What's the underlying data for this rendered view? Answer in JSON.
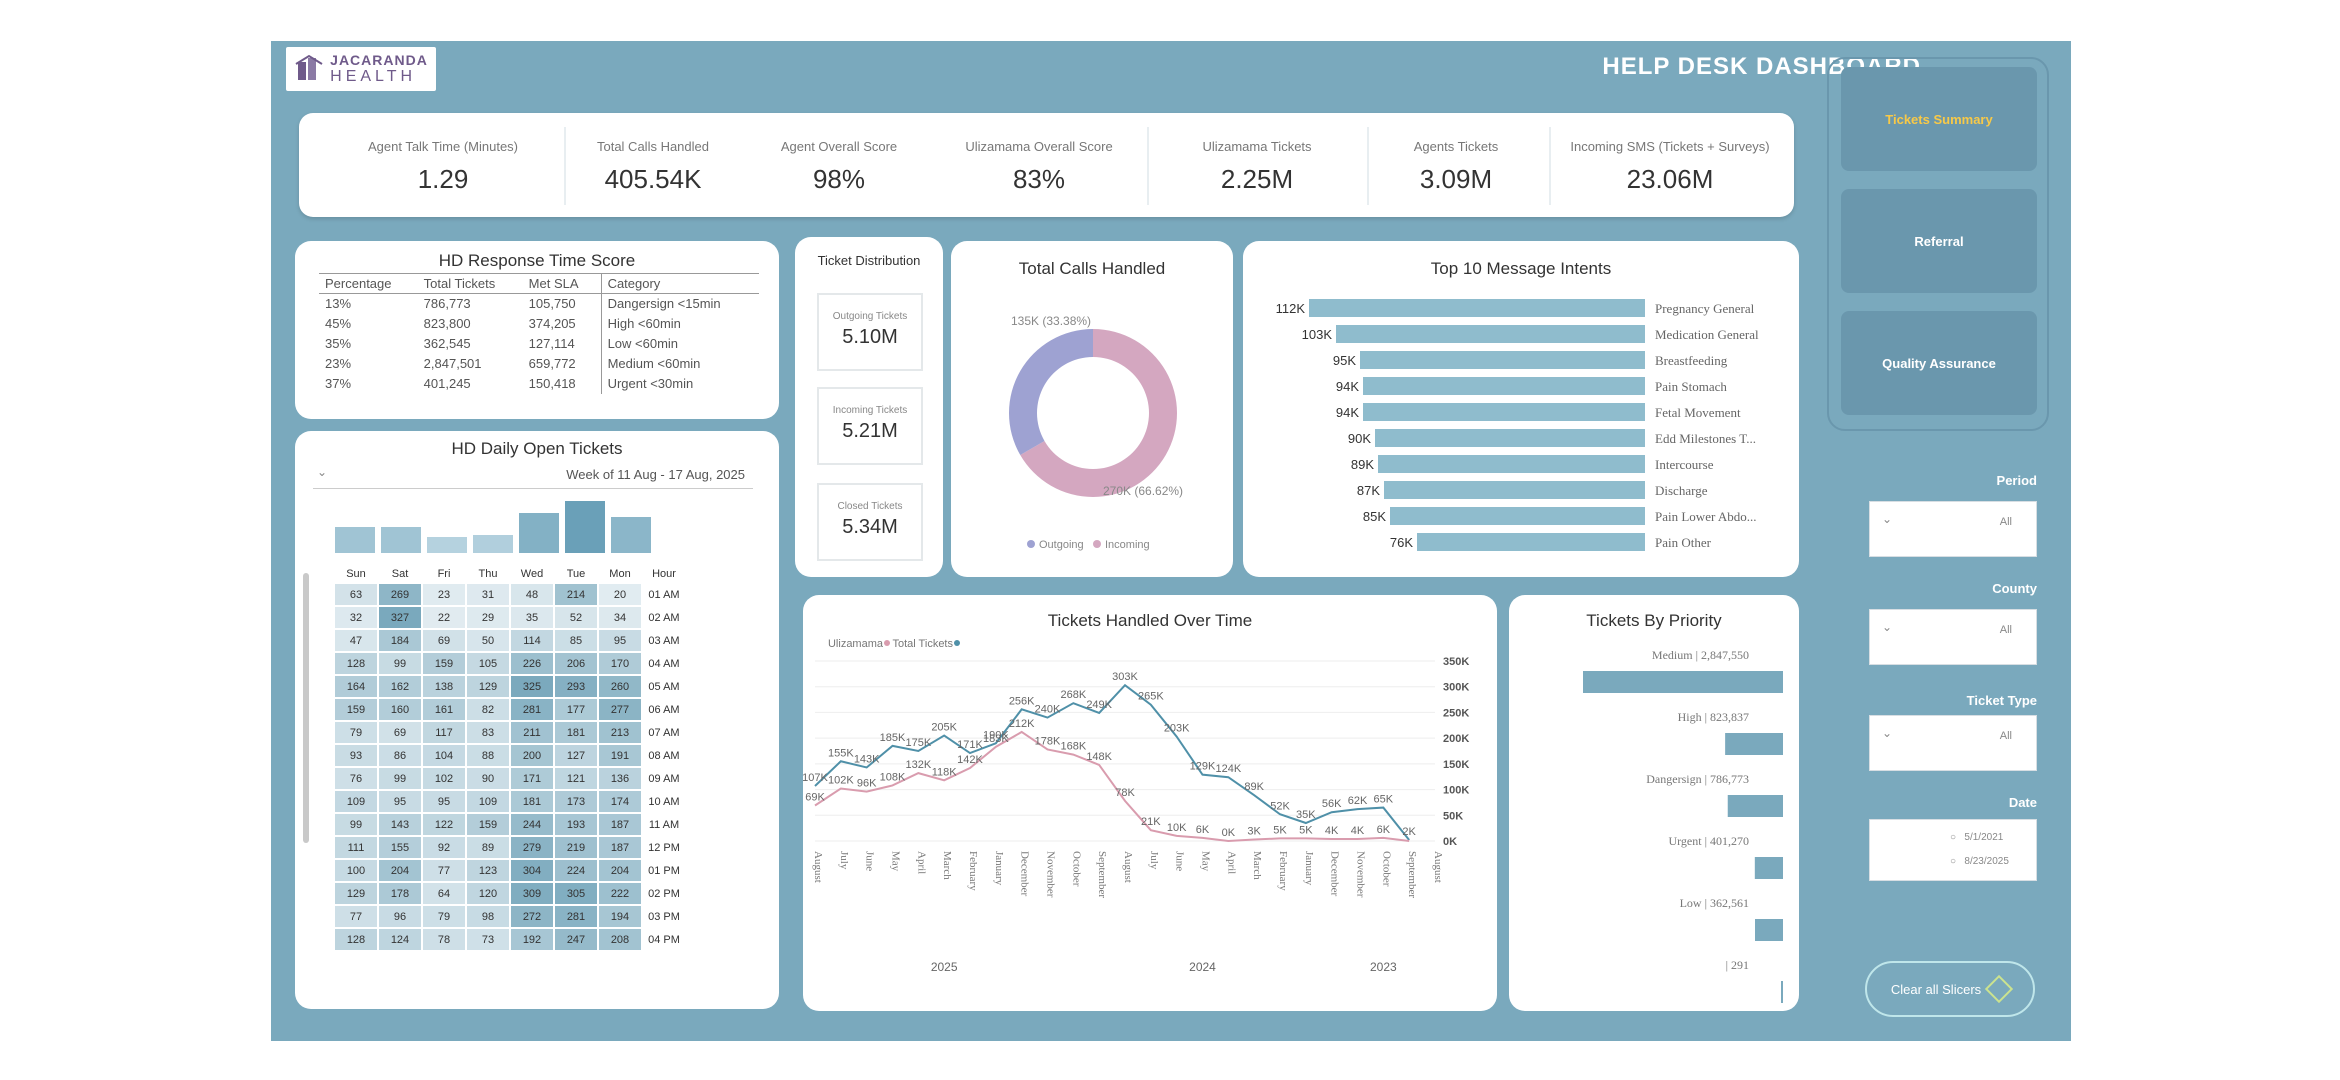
{
  "header": {
    "title": "HELP DESK DASHBOARD",
    "logo_top": "JACARANDA",
    "logo_bottom": "HEALTH"
  },
  "kpis": [
    {
      "label": "Incoming SMS (Tickets + Surveys)",
      "value": "23.06M"
    },
    {
      "label": "Agents Tickets",
      "value": "3.09M"
    },
    {
      "label": "Ulizamama Tickets",
      "value": "2.25M"
    },
    {
      "label": "Ulizamama Overall Score",
      "value": "83%"
    },
    {
      "label": "Agent Overall Score",
      "value": "98%"
    },
    {
      "label": "Total Calls Handled",
      "value": "405.54K"
    },
    {
      "label": "Agent Talk Time (Minutes)",
      "value": "1.29"
    }
  ],
  "nav": {
    "tickets_summary": "Tickets Summary",
    "referral": "Referral",
    "quality_assurance": "Quality Assurance",
    "active_color": "#f7c948"
  },
  "filters": {
    "period": {
      "label": "Period",
      "value": "All"
    },
    "county": {
      "label": "County",
      "value": "All"
    },
    "ticket_type": {
      "label": "Ticket Type",
      "value": "All"
    },
    "date": {
      "label": "Date",
      "start": "5/1/2021",
      "end": "8/23/2025"
    },
    "clear": "Clear all Slicers"
  },
  "hd_response": {
    "title": "HD Response Time Score",
    "columns": [
      "Category",
      "Met SLA",
      "Total Tickets",
      "Percentage"
    ],
    "rows": [
      [
        "Dangersign <15min",
        "105,750",
        "786,773",
        "13%"
      ],
      [
        "High <60min",
        "374,205",
        "823,800",
        "45%"
      ],
      [
        "Low <60min",
        "127,114",
        "362,545",
        "35%"
      ],
      [
        "Medium <60min",
        "659,772",
        "2,847,501",
        "23%"
      ],
      [
        "Urgent <30min",
        "150,418",
        "401,245",
        "37%"
      ]
    ]
  },
  "ticket_distribution": {
    "title": "Ticket Distribution",
    "outgoing_label": "Outgoing Tickets",
    "outgoing_value": "5.10M",
    "incoming_label": "Incoming Tickets",
    "incoming_value": "5.21M",
    "closed_label": "Closed Tickets",
    "closed_value": "5.34M"
  },
  "calls_handled": {
    "title": "Total Calls Handled",
    "incoming_label": "270K (66.62%)",
    "outgoing_label": "135K (33.38%)",
    "legend_incoming": "Incoming",
    "legend_outgoing": "Outgoing",
    "incoming_color": "#d4a7c0",
    "outgoing_color": "#9ea2d2",
    "incoming_value": 270,
    "outgoing_value": 135
  },
  "message_intents": {
    "title": "Top 10 Message Intents",
    "color": "#8fbccd",
    "rows": [
      {
        "name": "Pregnancy General",
        "label": "112K",
        "value": 112
      },
      {
        "name": "Medication General",
        "label": "103K",
        "value": 103
      },
      {
        "name": "Breastfeeding",
        "label": "95K",
        "value": 95
      },
      {
        "name": "Pain Stomach",
        "label": "94K",
        "value": 94
      },
      {
        "name": "Fetal Movement",
        "label": "94K",
        "value": 94
      },
      {
        "name": "Edd Milestones T...",
        "label": "90K",
        "value": 90
      },
      {
        "name": "Intercourse",
        "label": "89K",
        "value": 89
      },
      {
        "name": "Discharge",
        "label": "87K",
        "value": 87
      },
      {
        "name": "Pain Lower Abdo...",
        "label": "85K",
        "value": 85
      },
      {
        "name": "Pain Other",
        "label": "76K",
        "value": 76
      }
    ]
  },
  "open_tickets": {
    "title": "HD Daily Open Tickets",
    "week": "Week of 11 Aug - 17 Aug, 2025",
    "hour_label": "Hour",
    "days": [
      "Mon",
      "Tue",
      "Wed",
      "Thu",
      "Fri",
      "Sat",
      "Sun"
    ],
    "day_totals": [
      18,
      26,
      20,
      9,
      8,
      13,
      13
    ],
    "rows": [
      {
        "h": "01 AM",
        "v": [
          20,
          214,
          48,
          31,
          23,
          269,
          63
        ]
      },
      {
        "h": "02 AM",
        "v": [
          34,
          52,
          35,
          29,
          22,
          327,
          32
        ]
      },
      {
        "h": "03 AM",
        "v": [
          95,
          85,
          114,
          50,
          69,
          184,
          47
        ]
      },
      {
        "h": "04 AM",
        "v": [
          170,
          206,
          226,
          105,
          159,
          99,
          128
        ]
      },
      {
        "h": "05 AM",
        "v": [
          260,
          293,
          325,
          129,
          138,
          162,
          164
        ]
      },
      {
        "h": "06 AM",
        "v": [
          277,
          177,
          281,
          82,
          161,
          160,
          159
        ]
      },
      {
        "h": "07 AM",
        "v": [
          213,
          181,
          211,
          83,
          117,
          69,
          79
        ]
      },
      {
        "h": "08 AM",
        "v": [
          191,
          127,
          200,
          88,
          104,
          86,
          93
        ]
      },
      {
        "h": "09 AM",
        "v": [
          136,
          121,
          171,
          90,
          102,
          99,
          76
        ]
      },
      {
        "h": "10 AM",
        "v": [
          174,
          173,
          181,
          109,
          95,
          95,
          109
        ]
      },
      {
        "h": "11 AM",
        "v": [
          187,
          193,
          244,
          159,
          122,
          143,
          99
        ]
      },
      {
        "h": "12 PM",
        "v": [
          187,
          219,
          279,
          89,
          92,
          155,
          111
        ]
      },
      {
        "h": "01 PM",
        "v": [
          204,
          224,
          304,
          123,
          77,
          204,
          100
        ]
      },
      {
        "h": "02 PM",
        "v": [
          222,
          305,
          309,
          120,
          64,
          178,
          129
        ]
      },
      {
        "h": "03 PM",
        "v": [
          194,
          281,
          272,
          98,
          79,
          96,
          77
        ]
      },
      {
        "h": "04 PM",
        "v": [
          208,
          247,
          192,
          73,
          78,
          124,
          128
        ]
      }
    ]
  },
  "chart_data": [
    {
      "type": "line",
      "title": "Tickets Handled Over Time",
      "x": [
        "August 2025",
        "July 2025",
        "June 2025",
        "May 2025",
        "April 2025",
        "March 2025",
        "February 2025",
        "January 2025",
        "December 2024",
        "November 2024",
        "October 2024",
        "September 2024",
        "August 2024",
        "July 2024",
        "June 2024",
        "May 2024",
        "April 2024",
        "March 2024",
        "February 2024",
        "January 2024",
        "December 2023",
        "November 2023",
        "October 2023",
        "September 2023",
        "August 2023"
      ],
      "x_tick_labels": [
        "August",
        "July",
        "June",
        "May",
        "April",
        "March",
        "February",
        "January",
        "December",
        "November",
        "October",
        "September",
        "August",
        "July",
        "June",
        "May",
        "April",
        "March",
        "February",
        "January",
        "December",
        "November",
        "October",
        "September",
        "August"
      ],
      "year_labels": [
        "2025",
        "2024",
        "2023"
      ],
      "series": [
        {
          "name": "Total Tickets",
          "color": "#4f90a8",
          "values": [
            107,
            155,
            143,
            185,
            175,
            205,
            171,
            190,
            256,
            240,
            268,
            249,
            303,
            265,
            203,
            129,
            124,
            89,
            52,
            35,
            56,
            62,
            65,
            2,
            null
          ],
          "labels": [
            "107K",
            "155K",
            "143K",
            "185K",
            "175K",
            "205K",
            "171K",
            "190K",
            "256K",
            "240K",
            "268K",
            "249K",
            "303K",
            "265K",
            "203K",
            "129K",
            "124K",
            "89K",
            "52K",
            "35K",
            "56K",
            "62K",
            "65K",
            "2K",
            ""
          ]
        },
        {
          "name": "Ulizamama",
          "color": "#d99cae",
          "values": [
            69,
            102,
            96,
            108,
            132,
            118,
            142,
            183,
            212,
            178,
            168,
            148,
            78,
            21,
            10,
            6,
            0,
            3,
            5,
            5,
            4,
            4,
            6,
            0,
            null
          ],
          "labels": [
            "69K",
            "102K",
            "96K",
            "108K",
            "132K",
            "118K",
            "142K",
            "183K",
            "212K",
            "178K",
            "168K",
            "148K",
            "78K",
            "21K",
            "10K",
            "6K",
            "0K",
            "3K",
            "5K",
            "5K",
            "4K",
            "4K",
            "6K",
            "",
            ""
          ]
        }
      ],
      "ylabel": "",
      "yticks": [
        "0K",
        "50K",
        "100K",
        "150K",
        "200K",
        "250K",
        "300K",
        "350K"
      ],
      "ylim": [
        0,
        350
      ]
    },
    {
      "type": "bar",
      "title": "Tickets By Priority",
      "categories": [
        "Medium",
        "High",
        "Dangersign",
        "Urgent",
        "Low",
        ""
      ],
      "labels": [
        "Medium | 2,847,550",
        "High | 823,837",
        "Dangersign | 786,773",
        "Urgent | 401,270",
        "Low | 362,561",
        "| 291"
      ],
      "values": [
        2847550,
        823837,
        786773,
        401270,
        362561,
        291
      ],
      "color": "#7aa9bd"
    }
  ]
}
